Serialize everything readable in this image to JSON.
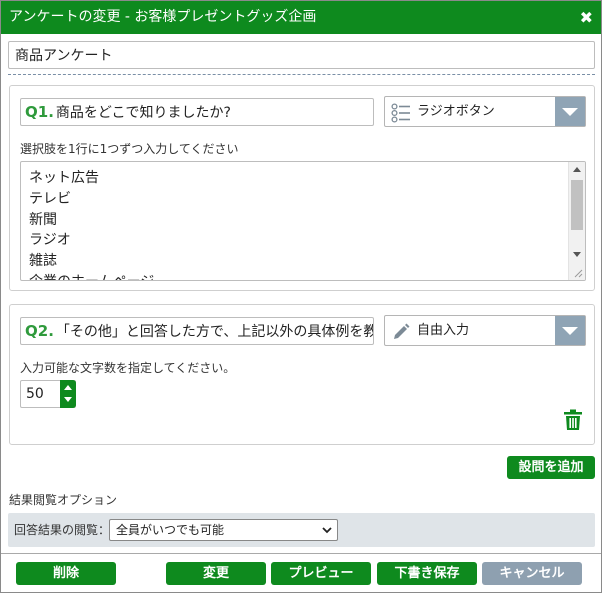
{
  "window": {
    "title": "アンケートの変更 - お客様プレゼントグッズ企画",
    "close_glyph": "✖"
  },
  "survey_title": "商品アンケート",
  "questions": [
    {
      "number": "Q1.",
      "text": "商品をどこで知りましたか?",
      "type_label": "ラジオボタン",
      "type_icon": "radio-list-icon",
      "hint": "選択肢を1行に1つずつ入力してください",
      "choices": [
        "ネット広告",
        "テレビ",
        "新聞",
        "ラジオ",
        "雑誌",
        "企業のホームページ"
      ]
    },
    {
      "number": "Q2.",
      "text": "「その他」と回答した方で、上記以外の具体例を教",
      "type_label": "自由入力",
      "type_icon": "pencil-icon",
      "hint": "入力可能な文字数を指定してください。",
      "max_chars": "50"
    }
  ],
  "buttons": {
    "add_question": "設問を追加",
    "delete": "削除",
    "change": "変更",
    "preview": "プレビュー",
    "save_draft": "下書き保存",
    "cancel": "キャンセル"
  },
  "result_options": {
    "section_label": "結果閲覧オプション",
    "view_label": "回答結果の閲覧：",
    "view_value": "全員がいつでも可能"
  },
  "colors": {
    "accent": "#0e8a1e",
    "dropdown_arrow": "#8fa4b5",
    "qnum": "#2f9a3c",
    "cancel": "#8ea0b0"
  }
}
